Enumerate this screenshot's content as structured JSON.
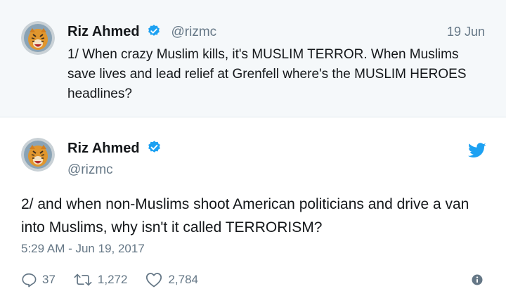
{
  "parent_tweet": {
    "author_name": "Riz Ahmed",
    "handle": "@rizmc",
    "date": "19 Jun",
    "text": "1/ When crazy Muslim kills, it's MUSLIM TERROR. When Muslims save lives and lead relief at Grenfell where's the MUSLIM HEROES headlines?"
  },
  "main_tweet": {
    "author_name": "Riz Ahmed",
    "handle": "@rizmc",
    "text": "2/ and when non-Muslims shoot American politicians and drive a van into Muslims, why isn't it called TERRORISM?",
    "timestamp": "5:29 AM - Jun 19, 2017",
    "replies": "37",
    "retweets": "1,272",
    "likes": "2,784"
  },
  "icons": {
    "verified": "verified-badge-icon",
    "brand": "twitter-bird-icon",
    "reply": "reply-icon",
    "retweet": "retweet-icon",
    "like": "heart-icon",
    "info": "info-icon"
  },
  "colors": {
    "brand_blue": "#1da1f2",
    "secondary_text": "#657786",
    "parent_background": "#f5f8fa"
  }
}
